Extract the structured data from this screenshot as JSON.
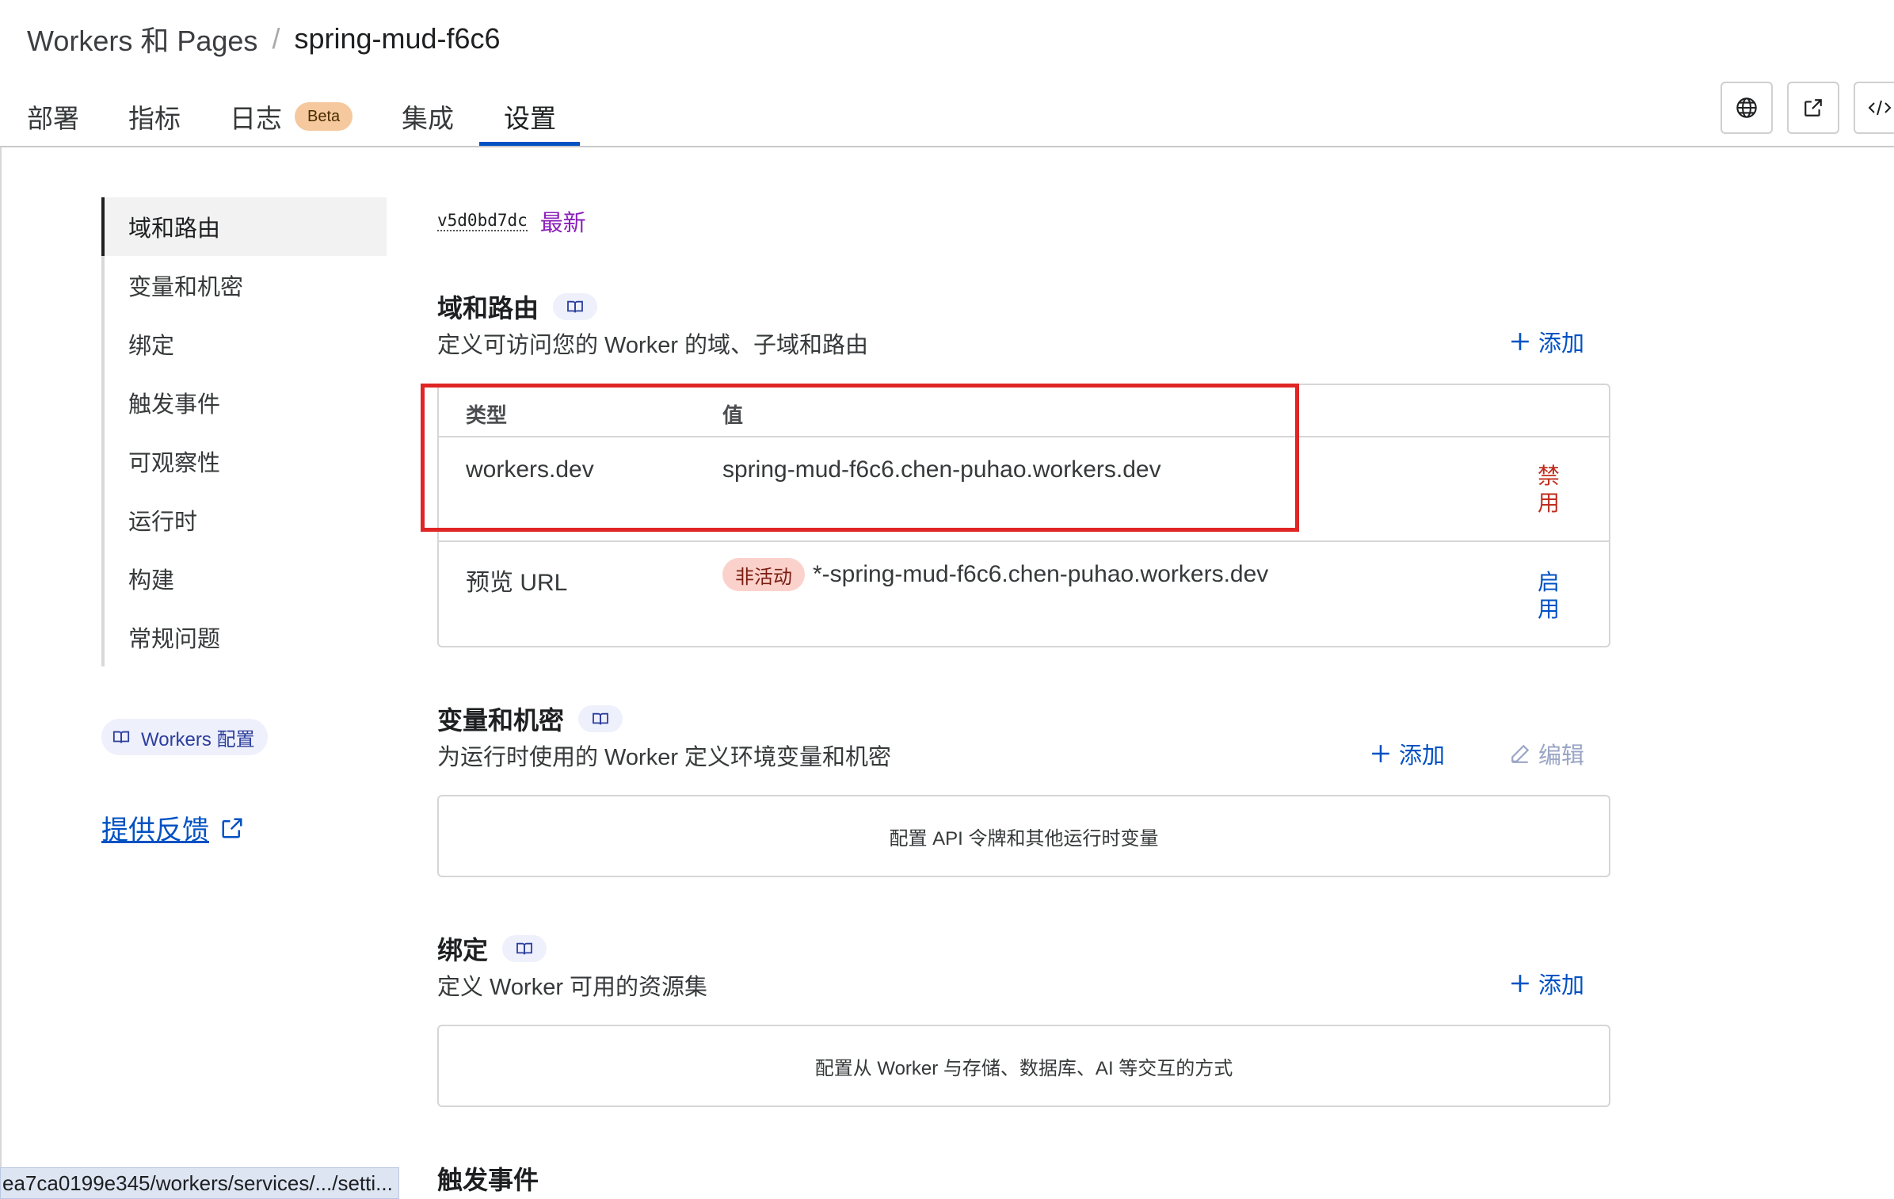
{
  "breadcrumb": {
    "parent": "Workers 和 Pages",
    "separator": "/",
    "current": "spring-mud-f6c6"
  },
  "tabs": [
    {
      "label": "部署"
    },
    {
      "label": "指标"
    },
    {
      "label": "日志",
      "badge": "Beta"
    },
    {
      "label": "集成"
    },
    {
      "label": "设置",
      "active": true
    }
  ],
  "header_icons": [
    "globe-icon",
    "external-link-icon",
    "code-icon"
  ],
  "sidebar": {
    "items": [
      {
        "label": "域和路由",
        "active": true
      },
      {
        "label": "变量和机密"
      },
      {
        "label": "绑定"
      },
      {
        "label": "触发事件"
      },
      {
        "label": "可观察性"
      },
      {
        "label": "运行时"
      },
      {
        "label": "构建"
      },
      {
        "label": "常规问题"
      }
    ],
    "docs_link": "Workers 配置",
    "feedback_link": "提供反馈"
  },
  "status_bar_url": "ea7ca0199e345/workers/services/.../setti...",
  "version": {
    "id": "v5d0bd7dc",
    "tag": "最新"
  },
  "domains": {
    "title": "域和路由",
    "description": "定义可访问您的 Worker 的域、子域和路由",
    "add_label": "添加",
    "columns": [
      "类型",
      "值"
    ],
    "rows": [
      {
        "type": "workers.dev",
        "value": "spring-mud-f6c6.chen-puhao.workers.dev",
        "status": "",
        "action": "禁用"
      },
      {
        "type": "预览 URL",
        "value": "*-spring-mud-f6c6.chen-puhao.workers.dev",
        "status": "非活动",
        "action": "启用"
      }
    ]
  },
  "variables": {
    "title": "变量和机密",
    "description": "为运行时使用的 Worker 定义环境变量和机密",
    "add_label": "添加",
    "edit_label": "编辑",
    "empty_text": "配置 API 令牌和其他运行时变量"
  },
  "bindings": {
    "title": "绑定",
    "description": "定义 Worker 可用的资源集",
    "add_label": "添加",
    "empty_text": "配置从 Worker 与存储、数据库、AI 等交互的方式"
  },
  "triggers": {
    "title": "触发事件"
  },
  "colors": {
    "accent": "#0051c3",
    "danger": "#c02d1e",
    "highlight": "#e02525",
    "latest": "#8b1fb8"
  }
}
